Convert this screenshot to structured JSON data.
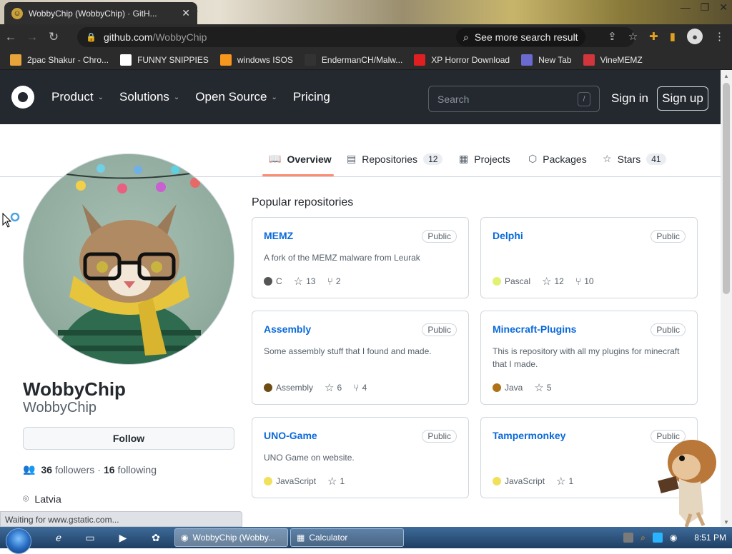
{
  "browser": {
    "tab_title": "WobbyChip (WobbyChip) · GitH...",
    "url_host": "github.com",
    "url_path": "/WobbyChip",
    "search_button": "See more search result",
    "bookmarks": [
      {
        "label": "2pac Shakur - Chro...",
        "icon": "2pac-icon",
        "color": "#e8a33a"
      },
      {
        "label": "FUNNY SNIPPIES",
        "icon": "h-icon",
        "color": "#ffffff"
      },
      {
        "label": "windows ISOS",
        "icon": "ph-icon",
        "color": "#f7971d"
      },
      {
        "label": "EndermanCH/Malw...",
        "icon": "yp-icon",
        "color": "#333333"
      },
      {
        "label": "XP Horror Download",
        "icon": "x-icon",
        "color": "#e02020"
      },
      {
        "label": "New Tab",
        "icon": "newtab-icon",
        "color": "#6a6ad0"
      },
      {
        "label": "VineMEMZ",
        "icon": "r-icon",
        "color": "#d0363c"
      }
    ],
    "status": "Waiting for www.gstatic.com..."
  },
  "github": {
    "nav": [
      {
        "label": "Product",
        "dropdown": true
      },
      {
        "label": "Solutions",
        "dropdown": true
      },
      {
        "label": "Open Source",
        "dropdown": true
      },
      {
        "label": "Pricing",
        "dropdown": false
      }
    ],
    "search_placeholder": "Search",
    "search_key": "/",
    "sign_in": "Sign in",
    "sign_up": "Sign up"
  },
  "profile_tabs": [
    {
      "label": "Overview",
      "count": null,
      "icon": "book-icon",
      "active": true
    },
    {
      "label": "Repositories",
      "count": "12",
      "icon": "repo-icon",
      "active": false
    },
    {
      "label": "Projects",
      "count": null,
      "icon": "table-icon",
      "active": false
    },
    {
      "label": "Packages",
      "count": null,
      "icon": "package-icon",
      "active": false
    },
    {
      "label": "Stars",
      "count": "41",
      "icon": "star-icon",
      "active": false
    }
  ],
  "profile": {
    "display_name": "WobbyChip",
    "username": "WobbyChip",
    "follow": "Follow",
    "followers_count": "36",
    "followers_label": "followers",
    "separator": "·",
    "following_count": "16",
    "following_label": "following",
    "location": "Latvia"
  },
  "popular_title": "Popular repositories",
  "public_label": "Public",
  "repos": [
    {
      "name": "MEMZ",
      "desc": "A fork of the MEMZ malware from Leurak",
      "lang": "C",
      "lang_color": "#555555",
      "stars": "13",
      "forks": "2"
    },
    {
      "name": "Delphi",
      "desc": "",
      "lang": "Pascal",
      "lang_color": "#E3F171",
      "stars": "12",
      "forks": "10"
    },
    {
      "name": "Assembly",
      "desc": "Some assembly stuff that I found and made.",
      "lang": "Assembly",
      "lang_color": "#6E4C13",
      "stars": "6",
      "forks": "4"
    },
    {
      "name": "Minecraft-Plugins",
      "desc": "This is repository with all my plugins for minecraft that I made.",
      "lang": "Java",
      "lang_color": "#b07219",
      "stars": "5",
      "forks": null
    },
    {
      "name": "UNO-Game",
      "desc": "UNO Game on website.",
      "lang": "JavaScript",
      "lang_color": "#f1e05a",
      "stars": "1",
      "forks": null
    },
    {
      "name": "Tampermonkey",
      "desc": "",
      "lang": "JavaScript",
      "lang_color": "#f1e05a",
      "stars": "1",
      "forks": null
    }
  ],
  "taskbar": {
    "tasks": [
      {
        "label": "WobbyChip (Wobby...",
        "icon": "chrome-icon"
      },
      {
        "label": "Calculator",
        "icon": "calculator-icon"
      }
    ],
    "clock": "8:51 PM"
  }
}
